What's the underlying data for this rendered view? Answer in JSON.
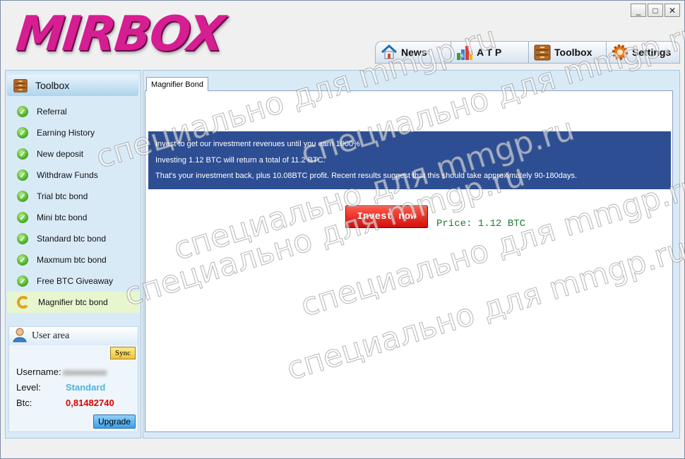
{
  "app": {
    "logo_text": "MIRBOX"
  },
  "window_controls": {
    "minimize": "_",
    "maximize": "□",
    "close": "✕"
  },
  "topnav": [
    {
      "label": "News",
      "icon": "house-icon"
    },
    {
      "label": "A T P",
      "icon": "bar-chart-icon"
    },
    {
      "label": "Toolbox",
      "icon": "toolbox-icon"
    },
    {
      "label": "Settings",
      "icon": "gear-icon"
    }
  ],
  "sidebar": {
    "title": "Toolbox",
    "items": [
      {
        "label": "Referral"
      },
      {
        "label": "Earning History"
      },
      {
        "label": "New deposit"
      },
      {
        "label": "Withdraw Funds"
      },
      {
        "label": "Trial btc bond"
      },
      {
        "label": "Mini btc bond"
      },
      {
        "label": "Standard btc bond"
      },
      {
        "label": "Maxmum btc bond"
      },
      {
        "label": "Free BTC Giveaway"
      },
      {
        "label": "Magnifier btc bond"
      }
    ]
  },
  "user_area": {
    "title": "User area",
    "sync_label": "Sync",
    "username_label": "Username:",
    "level_label": "Level:",
    "level_value": "Standard",
    "btc_label": "Btc:",
    "btc_value": "0,81482740",
    "upgrade_label": "Upgrade",
    "colors": {
      "level": "#4fb3d9",
      "btc": "#e00000"
    }
  },
  "main": {
    "tab_label": "Magnifier Bond",
    "banner": [
      "Invest to get our investment revenues until you earn 1000%",
      "Investing 1.12 BTC will return a total of 11.2 BTC.",
      "That's your investment back, plus 10.08BTC profit. Recent results suggest that this should take approximately 90-180days."
    ],
    "invest_label": "Invest now",
    "price_text": "Price: 1.12 BTC"
  },
  "watermark": "специально для mmgp.ru"
}
